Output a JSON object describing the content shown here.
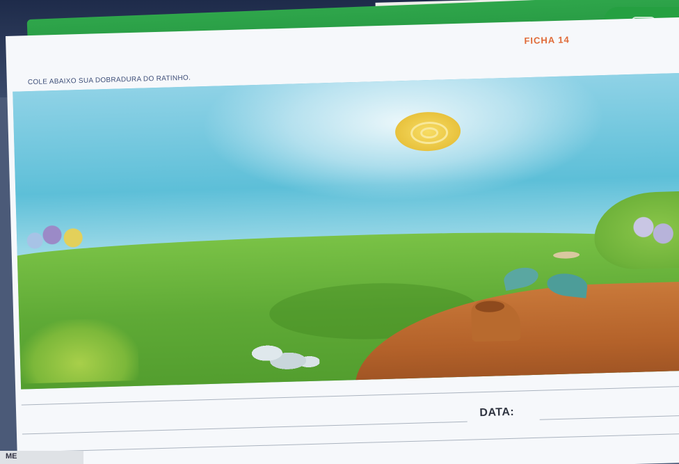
{
  "worksheet": {
    "instruction": "COLE ABAIXO SUA DOBRADURA DO RATINHO.",
    "sheet_number": "FICHA 14",
    "date_label": "DATA:",
    "name_label": "ME"
  },
  "colors": {
    "accent_orange": "#e06a37",
    "folder_green": "#2fa64b",
    "sky_blue": "#5dbfd8",
    "grass_green": "#5faa36",
    "log_brown": "#b4622a"
  }
}
